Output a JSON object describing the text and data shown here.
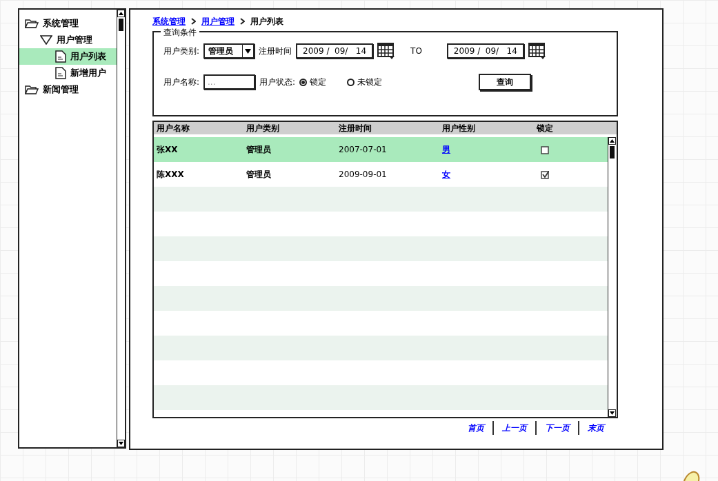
{
  "tree": [
    {
      "label": "系统管理",
      "kind": "folder",
      "selected": false,
      "children": [
        {
          "label": "用户管理",
          "kind": "group",
          "expanded": true,
          "selected": false,
          "children": [
            {
              "label": "用户列表",
              "kind": "page",
              "selected": true
            },
            {
              "label": "新增用户",
              "kind": "page",
              "selected": false
            }
          ]
        }
      ]
    },
    {
      "label": "新闻管理",
      "kind": "folder",
      "selected": false
    }
  ],
  "breadcrumb": [
    {
      "label": "系统管理",
      "link": true
    },
    {
      "label": "用户管理",
      "link": true
    },
    {
      "label": "用户列表",
      "link": false
    }
  ],
  "query": {
    "legend": "查询条件",
    "type_label": "用户类别:",
    "type_value": "管理员",
    "date_label": "注册时间",
    "date_from": "2009 /  09/   14",
    "to_label": "TO",
    "date_to": "2009 /  09/   14",
    "name_label": "用户名称:",
    "name_placeholder": "...",
    "status_label": "用户状态:",
    "status_options": [
      {
        "label": "锁定",
        "selected": true
      },
      {
        "label": "未锁定",
        "selected": false
      }
    ],
    "button": "查询"
  },
  "table": {
    "columns": [
      "用户名称",
      "用户类别",
      "注册时间",
      "用户性别",
      "锁定"
    ],
    "rows": [
      {
        "name": "张XX",
        "type": "管理员",
        "date": "2007-07-01",
        "gender": "男",
        "locked": false,
        "selected": true
      },
      {
        "name": "陈XXX",
        "type": "管理员",
        "date": "2009-09-01",
        "gender": "女",
        "locked": true,
        "selected": false
      }
    ]
  },
  "pagination": [
    "首页",
    "上一页",
    "下一页",
    "末页"
  ]
}
